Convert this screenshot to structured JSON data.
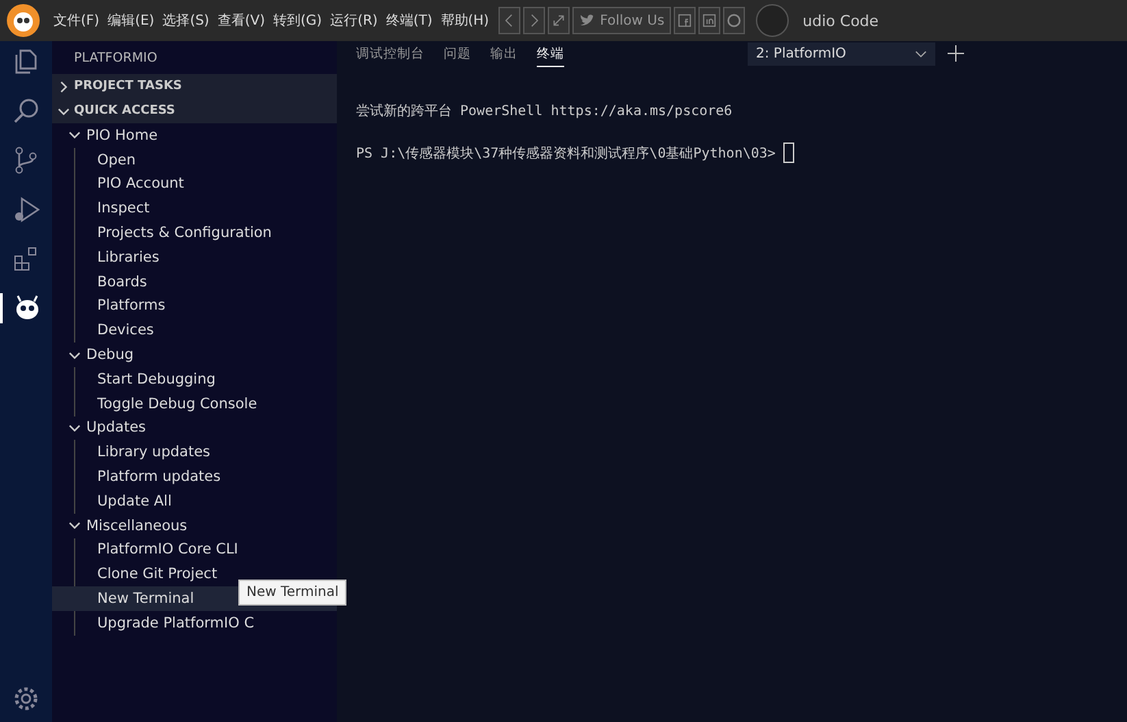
{
  "menu_bar": {
    "items": [
      "文件(F)",
      "编辑(E)",
      "选择(S)",
      "查看(V)",
      "转到(G)",
      "运行(R)",
      "终端(T)",
      "帮助(H)"
    ],
    "overlay_toolbar": {
      "label": "Follow Us"
    },
    "window_title": "udio Code"
  },
  "sidebar": {
    "title": "PLATFORMIO",
    "sections": [
      {
        "label": "PROJECT TASKS",
        "expanded": false
      },
      {
        "label": "QUICK ACCESS",
        "expanded": true,
        "children": [
          {
            "label": "PIO Home",
            "expanded": true,
            "children": [
              {
                "label": "Open",
                "selected": false
              },
              {
                "label": "PIO Account",
                "selected": false
              },
              {
                "label": "Inspect",
                "selected": false
              },
              {
                "label": "Projects & Configuration",
                "selected": false
              },
              {
                "label": "Libraries",
                "selected": false
              },
              {
                "label": "Boards",
                "selected": false
              },
              {
                "label": "Platforms",
                "selected": false
              },
              {
                "label": "Devices",
                "selected": false
              }
            ]
          },
          {
            "label": "Debug",
            "expanded": true,
            "children": [
              {
                "label": "Start Debugging",
                "selected": false
              },
              {
                "label": "Toggle Debug Console",
                "selected": false
              }
            ]
          },
          {
            "label": "Updates",
            "expanded": true,
            "children": [
              {
                "label": "Library updates",
                "selected": false
              },
              {
                "label": "Platform updates",
                "selected": false
              },
              {
                "label": "Update All",
                "selected": false
              }
            ]
          },
          {
            "label": "Miscellaneous",
            "expanded": true,
            "children": [
              {
                "label": "PlatformIO Core CLI",
                "selected": false
              },
              {
                "label": "Clone Git Project",
                "selected": false
              },
              {
                "label": "New Terminal",
                "selected": true
              },
              {
                "label": "Upgrade PlatformIO C",
                "selected": false
              }
            ]
          }
        ]
      }
    ]
  },
  "tooltip": "New Terminal",
  "panel": {
    "tabs": [
      {
        "label": "调试控制台",
        "selected": false
      },
      {
        "label": "问题",
        "selected": false
      },
      {
        "label": "输出",
        "selected": false
      },
      {
        "label": "终端",
        "selected": true
      }
    ],
    "terminal_select": "2: PlatformIO",
    "lines": [
      "尝试新的跨平台 PowerShell https://aka.ms/pscore6",
      "PS J:\\传感器模块\\37种传感器资料和测试程序\\0基础Python\\03>"
    ]
  }
}
